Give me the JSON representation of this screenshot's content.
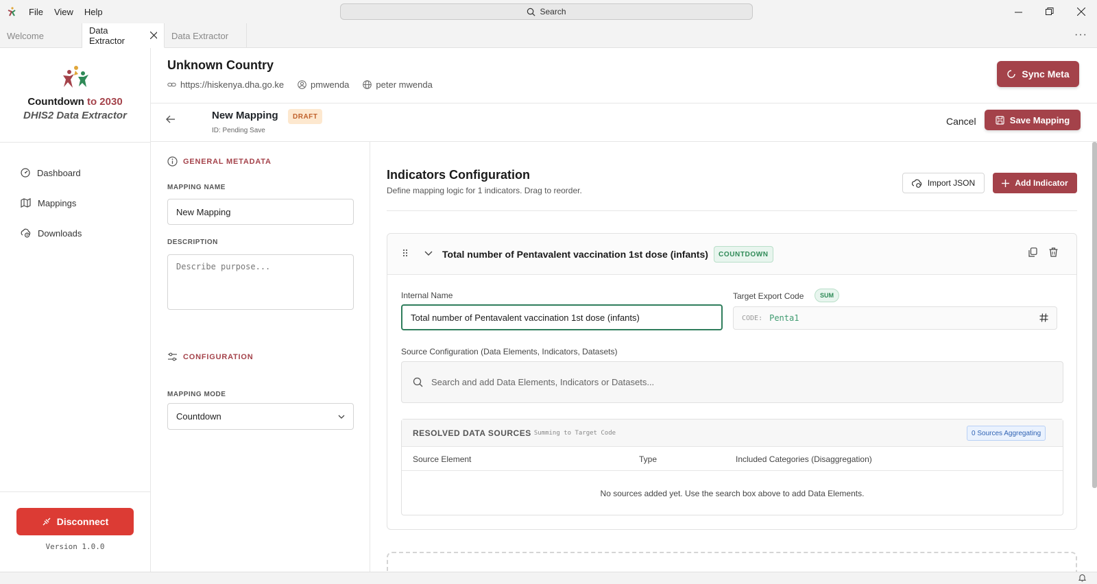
{
  "menu": {
    "file": "File",
    "view": "View",
    "help": "Help"
  },
  "titlebar": {
    "search_label": "Search"
  },
  "tabs": [
    {
      "label": "Welcome"
    },
    {
      "label": "Data Extractor"
    },
    {
      "label": "Data Extractor"
    }
  ],
  "sidebar": {
    "brand_line1_a": "Countdown",
    "brand_line1_b": "to 2030",
    "brand_line2": "DHIS2 Data Extractor",
    "items": [
      {
        "label": "Dashboard",
        "icon": "dashboard-icon"
      },
      {
        "label": "Mappings",
        "icon": "map-icon"
      },
      {
        "label": "Downloads",
        "icon": "download-icon"
      }
    ],
    "disconnect_label": "Disconnect",
    "version": "Version 1.0.0"
  },
  "header": {
    "country": "Unknown Country",
    "url": "https://hiskenya.dha.go.ke",
    "username": "pmwenda",
    "fullname": "peter mwenda",
    "sync_label": "Sync Meta"
  },
  "mapping": {
    "title": "New Mapping",
    "status": "DRAFT",
    "id_text": "ID: Pending Save",
    "cancel_label": "Cancel",
    "save_label": "Save Mapping"
  },
  "general": {
    "section_title": "GENERAL METADATA",
    "name_label": "MAPPING NAME",
    "name_value": "New Mapping",
    "desc_label": "DESCRIPTION",
    "desc_placeholder": "Describe purpose...",
    "config_title": "CONFIGURATION",
    "mode_label": "MAPPING MODE",
    "mode_value": "Countdown"
  },
  "indicators": {
    "title": "Indicators Configuration",
    "subtitle": "Define mapping logic for 1 indicators. Drag to reorder.",
    "import_label": "Import JSON",
    "add_label": "Add Indicator",
    "items": [
      {
        "title": "Total number of Pentavalent vaccination 1st dose (infants)",
        "badge": "COUNTDOWN",
        "internal_name_label": "Internal Name",
        "internal_name_value": "Total number of Pentavalent vaccination 1st dose (infants)",
        "target_code_label": "Target Export Code",
        "aggregation_badge": "SUM",
        "code_prefix": "CODE:",
        "code_value": "Penta1",
        "source_label": "Source Configuration (Data Elements, Indicators, Datasets)",
        "source_placeholder": "Search and add Data Elements, Indicators or Datasets...",
        "resolved": {
          "title": "RESOLVED DATA SOURCES",
          "hint": "→ Summing to Target Code",
          "count_badge": "0 Sources Aggregating",
          "columns": [
            "Source Element",
            "Type",
            "Included Categories (Disaggregation)"
          ],
          "empty_message": "No sources added yet. Use the search box above to add Data Elements."
        }
      }
    ]
  },
  "colors": {
    "accent": "#a4424a",
    "danger": "#dc3b34",
    "success": "#2f8a57",
    "info": "#2f62b3"
  }
}
